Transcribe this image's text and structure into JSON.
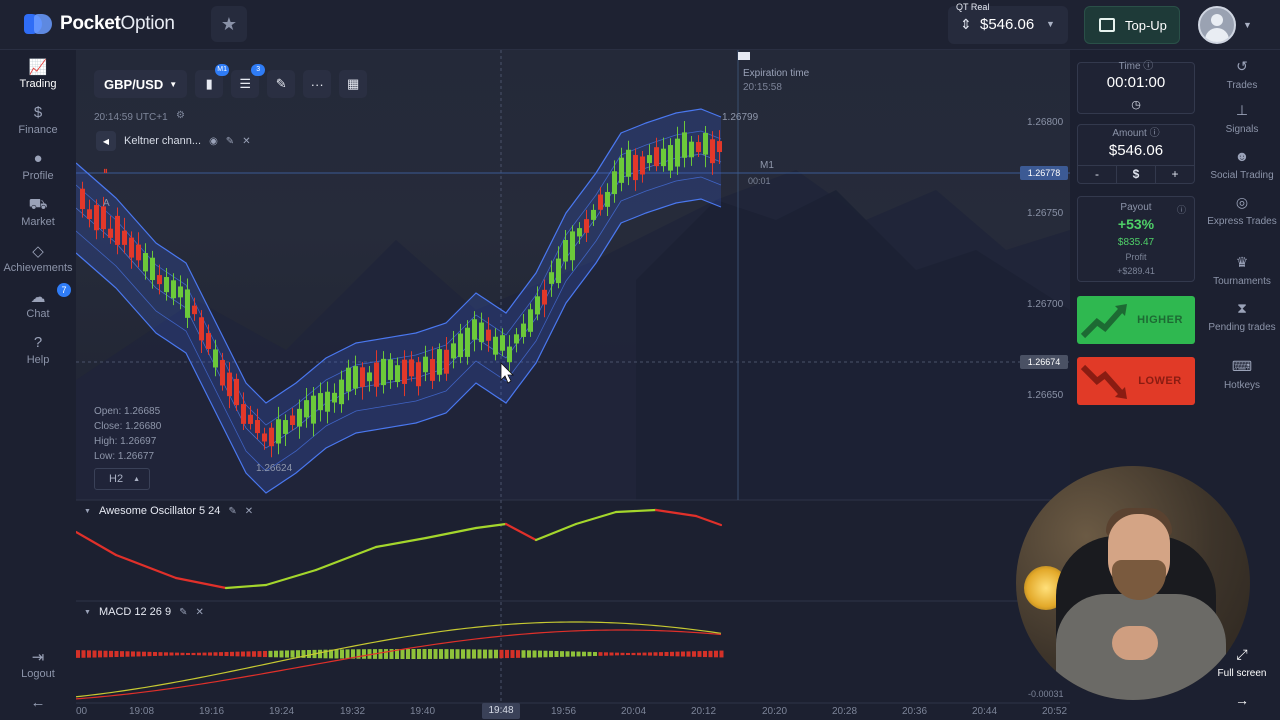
{
  "app": {
    "brand_bold": "Pocket",
    "brand_rest": "Option"
  },
  "account": {
    "type": "QT Real",
    "balance": "$546.06"
  },
  "topup_label": "Top-Up",
  "left_nav": [
    {
      "label": "Trading",
      "icon": "chart-line-icon",
      "active": true
    },
    {
      "label": "Finance",
      "icon": "dollar-icon"
    },
    {
      "label": "Profile",
      "icon": "user-icon"
    },
    {
      "label": "Market",
      "icon": "cart-icon"
    },
    {
      "label": "Achievements",
      "icon": "diamond-icon"
    },
    {
      "label": "Chat",
      "icon": "chat-icon",
      "badge": "7"
    },
    {
      "label": "Help",
      "icon": "help-icon"
    },
    {
      "label": "Logout",
      "icon": "logout-icon"
    }
  ],
  "toolbar": {
    "pair": "GBP/USD",
    "chart_type_badge": "M1",
    "indicators_badge": "3"
  },
  "chart_header": {
    "clock": "20:14:59 UTC+1",
    "indicator_name": "Keltner chann...",
    "expiration_label": "Expiration time",
    "expiration_value": "20:15:58",
    "period_label": "M1",
    "period_timer": "00:01",
    "high_tag": "1.26799",
    "low_tag": "1.26624"
  },
  "ohlc": {
    "open": "Open: 1.26685",
    "close": "Close: 1.26680",
    "high": "High: 1.26697",
    "low": "Low: 1.26677"
  },
  "timeframe": "H2",
  "y_axis": {
    "labels": [
      "1.26800",
      "1.26750",
      "1.26700",
      "1.26650"
    ],
    "current_price": "1.26778",
    "crosshair_price": "1.26674"
  },
  "sub_indicators": {
    "ao": "Awesome Oscillator 5 24",
    "macd": "MACD 12 26 9",
    "macd_min": "-0.00031"
  },
  "x_axis": {
    "labels": [
      "00",
      "19:08",
      "19:16",
      "19:24",
      "19:32",
      "19:40",
      "19:56",
      "20:04",
      "20:12",
      "20:20",
      "20:28",
      "20:36",
      "20:44",
      "20:52"
    ],
    "highlight": "19:48"
  },
  "trade_panel": {
    "time_label": "Time",
    "time_value": "00:01:00",
    "amount_label": "Amount",
    "amount_value": "$546.06",
    "minus": "-",
    "currency": "$",
    "plus": "+",
    "payout_label": "Payout",
    "payout_pct": "+53%",
    "payout_amount": "$835.47",
    "profit_label": "Profit",
    "profit_value": "+$289.41",
    "higher_label": "HIGHER",
    "lower_label": "LOWER"
  },
  "right_nav": [
    {
      "label": "Trades",
      "icon": "history-icon"
    },
    {
      "label": "Signals",
      "icon": "signal-icon"
    },
    {
      "label": "Social Trading",
      "icon": "people-icon"
    },
    {
      "label": "Express Trades",
      "icon": "target-icon"
    },
    {
      "label": "Tournaments",
      "icon": "trophy-icon"
    },
    {
      "label": "Pending trades",
      "icon": "hourglass-icon"
    },
    {
      "label": "Hotkeys",
      "icon": "keyboard-icon"
    },
    {
      "label": "Full screen",
      "icon": "fullscreen-icon"
    }
  ],
  "colors": {
    "up": "#6cc93a",
    "down": "#e2382a",
    "keltner": "#3a66e6",
    "accent": "#2f7cf6"
  }
}
